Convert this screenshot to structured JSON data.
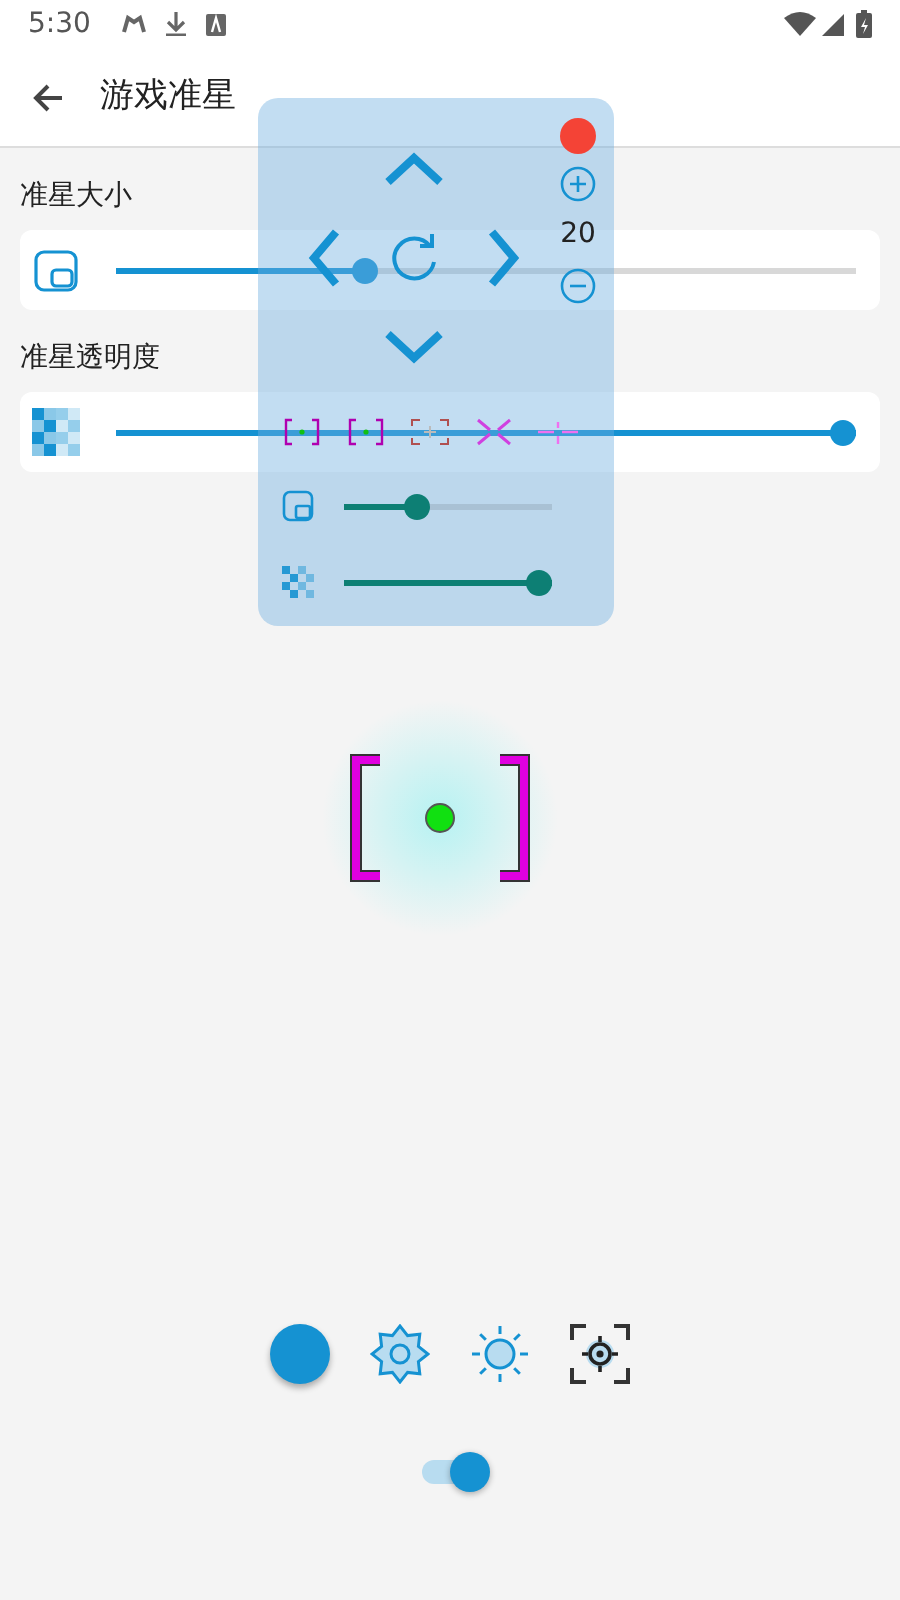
{
  "status_bar": {
    "time": "5:30"
  },
  "app_bar": {
    "title": "游戏准星"
  },
  "settings": [
    {
      "label": "准星大小",
      "kind": "size",
      "level": 0.33
    },
    {
      "label": "准星透明度",
      "kind": "opacity",
      "level": 1
    }
  ],
  "overlay": {
    "size_reading": "20",
    "size_slider": {
      "level": 0.33
    },
    "opacity_slider": {
      "level": 1
    }
  },
  "toggle": {
    "on": true
  }
}
